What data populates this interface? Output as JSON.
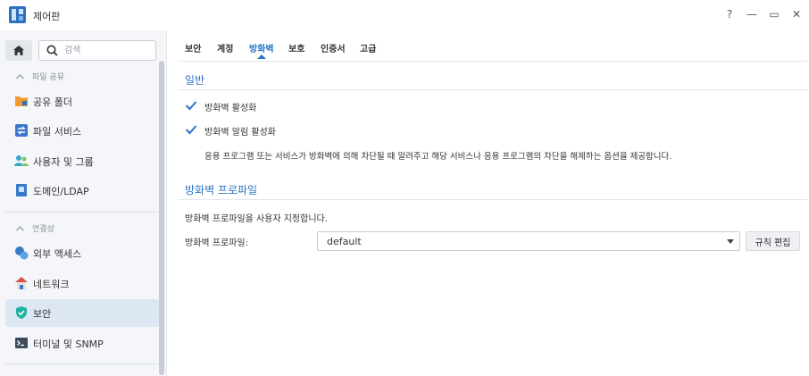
{
  "window": {
    "title": "제어판",
    "controls": {
      "help": "?",
      "minimize": "—",
      "maximize": "▭",
      "close": "✕"
    }
  },
  "sidebar": {
    "search_placeholder": "검색",
    "sections": [
      {
        "label": "파일 공유",
        "items": [
          {
            "label": "공유 폴더",
            "icon": "shared-folder-icon"
          },
          {
            "label": "파일 서비스",
            "icon": "file-services-icon"
          },
          {
            "label": "사용자 및 그룹",
            "icon": "user-group-icon"
          },
          {
            "label": "도메인/LDAP",
            "icon": "domain-ldap-icon"
          }
        ]
      },
      {
        "label": "연결성",
        "items": [
          {
            "label": "외부 액세스",
            "icon": "external-access-icon"
          },
          {
            "label": "네트워크",
            "icon": "network-icon"
          },
          {
            "label": "보안",
            "icon": "security-shield-icon",
            "active": true
          },
          {
            "label": "터미널 및 SNMP",
            "icon": "terminal-icon"
          }
        ]
      }
    ]
  },
  "tabs": [
    {
      "label": "보안"
    },
    {
      "label": "계정"
    },
    {
      "label": "방화벽",
      "active": true
    },
    {
      "label": "보호"
    },
    {
      "label": "인증서"
    },
    {
      "label": "고급"
    }
  ],
  "general": {
    "title": "일반",
    "enable_firewall": {
      "label": "방화벽 활성화",
      "checked": true
    },
    "enable_notifications": {
      "label": "방화벽 알림 활성화",
      "checked": true
    },
    "notification_desc": "응용 프로그램 또는 서비스가 방화벽에 의해 차단될 때 알려주고 해당 서비스나 응용 프로그램의 차단을 해제하는 옵션을 제공합니다."
  },
  "profile": {
    "title": "방화벽 프로파일",
    "desc": "방화벽 프로파일을 사용자 지정합니다.",
    "field_label": "방화벽 프로파일:",
    "selected": "default",
    "edit_button": "규칙 편집"
  },
  "colors": {
    "accent": "#2a74c5",
    "sidebar_bg": "#f4f6f9",
    "active_item_bg": "#dce7f3"
  }
}
